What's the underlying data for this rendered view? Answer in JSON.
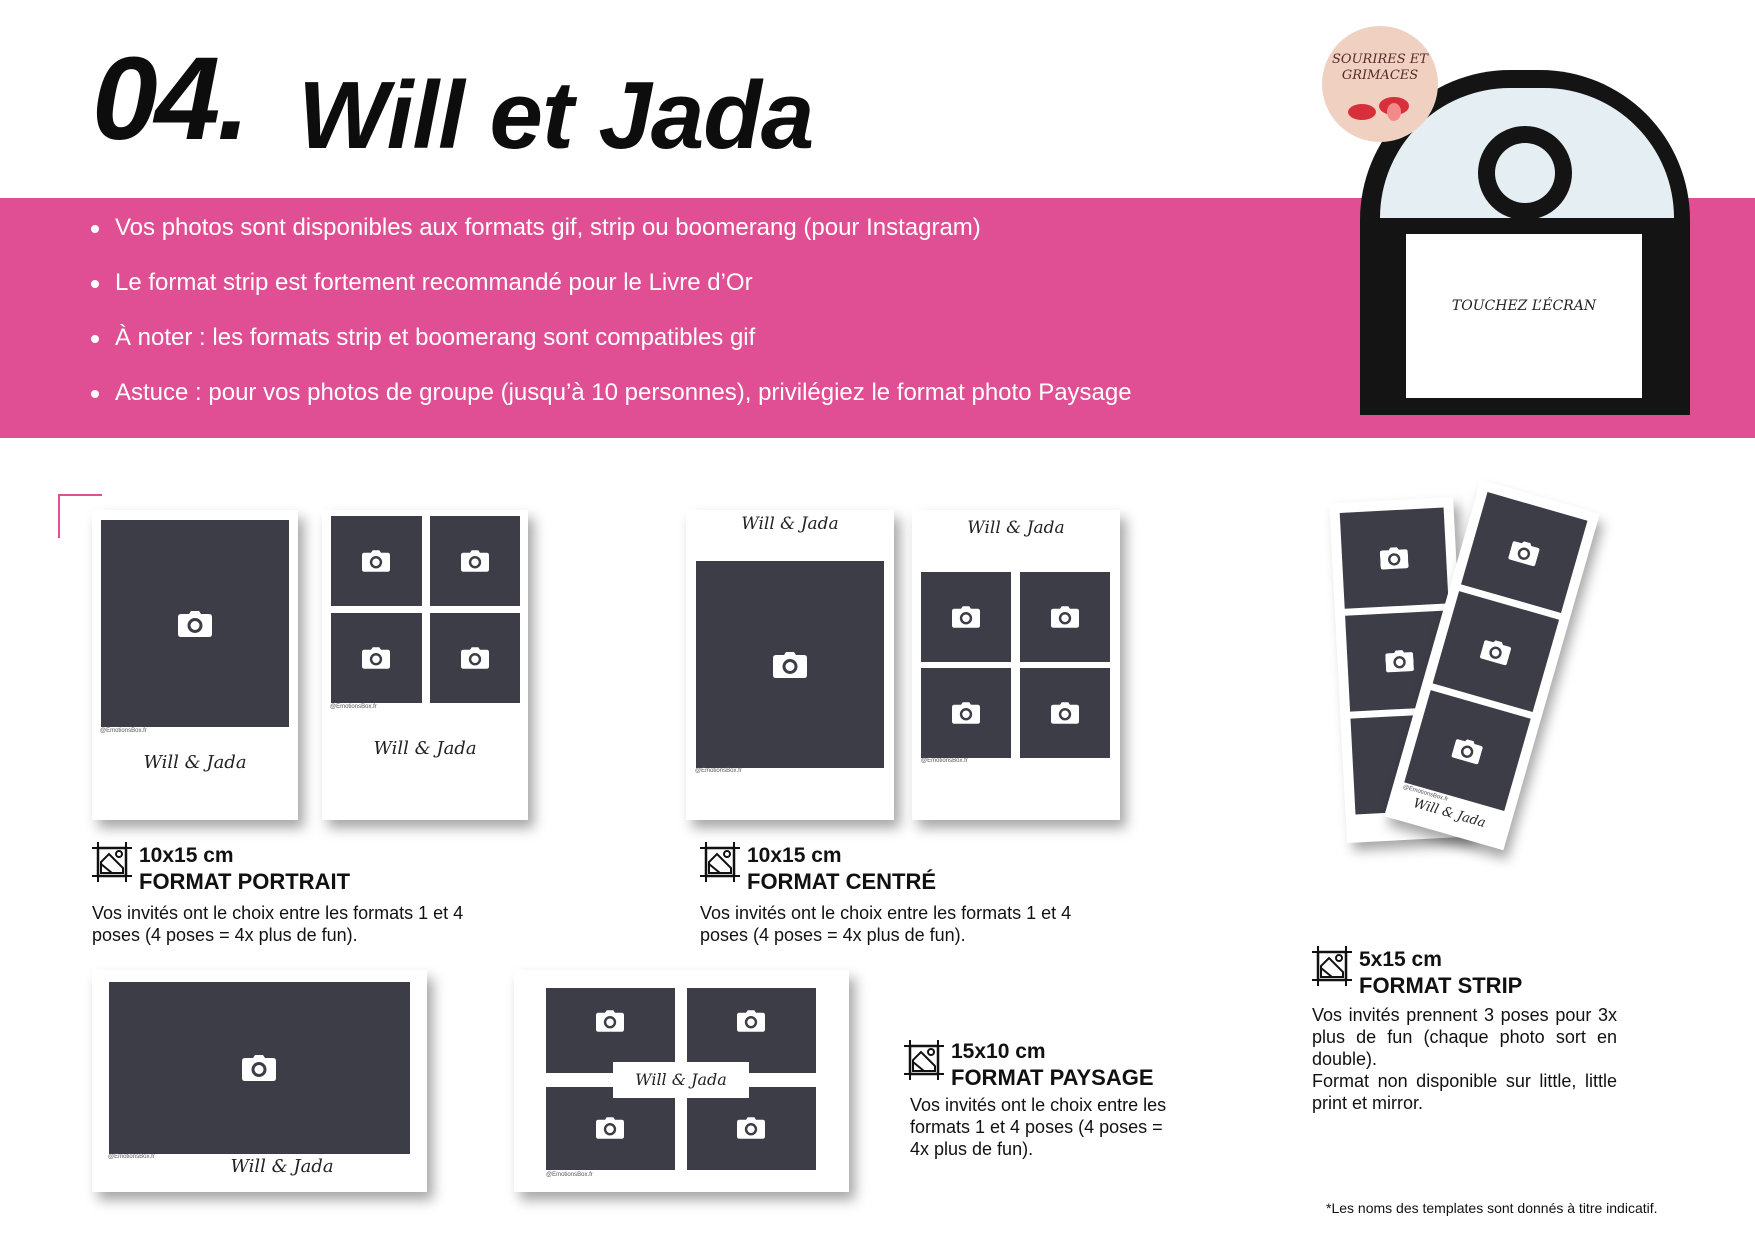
{
  "title": {
    "number": "04.",
    "name": "Will et Jada"
  },
  "bullets": [
    "Vos photos sont disponibles aux formats gif, strip ou boomerang (pour Instagram)",
    "Le format strip est fortement recommandé pour le Livre d’Or",
    "À noter : les formats strip et boomerang sont compatibles gif",
    "Astuce : pour vos photos de groupe (jusqu’à 10 personnes), privilégiez le format photo Paysage"
  ],
  "booth": {
    "badge": "SOURIRES ET GRIMACES",
    "screen": "TOUCHEZ L’ÉCRAN"
  },
  "template_script": "Will & Jada",
  "credit": "@EmotionsBox.fr",
  "formats": [
    {
      "size": "10x15 cm",
      "name": "FORMAT PORTRAIT",
      "desc": "Vos invités ont le choix entre les formats 1 et 4 poses (4 poses = 4x plus de fun)."
    },
    {
      "size": "10x15 cm",
      "name": "FORMAT CENTRÉ",
      "desc": "Vos invités ont le choix entre les formats 1 et 4 poses (4 poses = 4x plus de fun)."
    },
    {
      "size": "5x15 cm",
      "name": "FORMAT STRIP",
      "desc": "Vos invités prennent 3 poses pour 3x plus de fun (chaque photo sort en double).",
      "desc2": "Format non disponible sur little, little print et mirror."
    },
    {
      "size": "15x10 cm",
      "name": "FORMAT PAYSAGE",
      "desc": "Vos invités ont le choix entre les formats 1 et 4 poses (4 poses = 4x plus de fun)."
    }
  ],
  "footnote": "*Les noms des templates sont donnés à titre indicatif.",
  "colors": {
    "accent": "#e04f93",
    "photo": "#3d3d48",
    "booth": "#141414"
  }
}
